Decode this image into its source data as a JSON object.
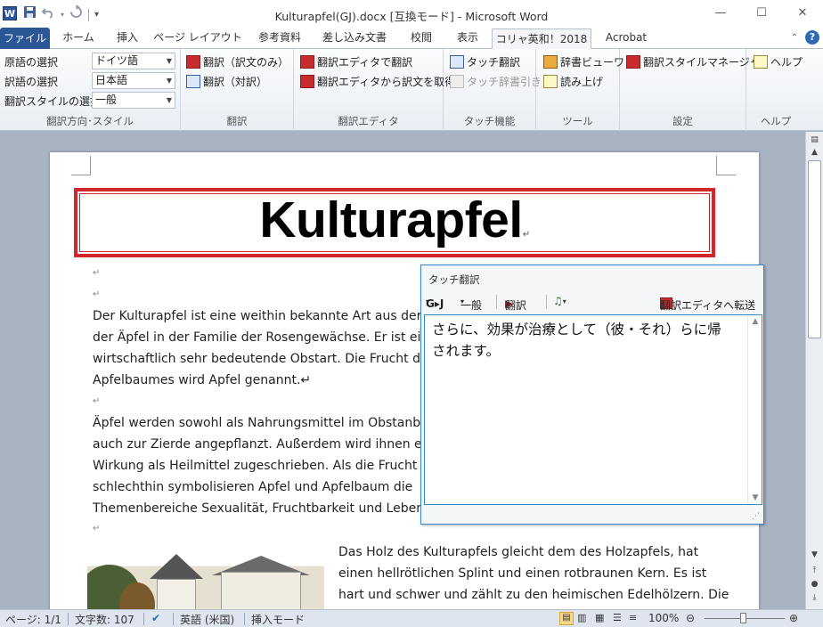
{
  "window": {
    "title": "Kulturapfel(GJ).docx [互換モード] - Microsoft Word",
    "app_icon_label": "W",
    "controls": {
      "minimize": "—",
      "maximize": "☐",
      "close": "✕"
    }
  },
  "quick_access": {
    "save_icon": "save-icon",
    "undo_icon": "undo-icon",
    "redo_icon": "redo-icon",
    "customize_icon": "customize-icon"
  },
  "tabs": [
    {
      "label": "ファイル"
    },
    {
      "label": "ホーム"
    },
    {
      "label": "挿入"
    },
    {
      "label": "ページ レイアウト"
    },
    {
      "label": "参考資料"
    },
    {
      "label": "差し込み文書"
    },
    {
      "label": "校閲"
    },
    {
      "label": "表示"
    },
    {
      "label": "コリャ英和！2018"
    },
    {
      "label": "Acrobat"
    }
  ],
  "active_tab": "コリャ英和！2018",
  "tab_help": "?",
  "ribbon": {
    "direction_group": {
      "label": "翻訳方向･スタイル",
      "source_label": "原語の選択",
      "source_value": "ドイツ語",
      "target_label": "訳語の選択",
      "target_value": "日本語",
      "style_label": "翻訳スタイルの選択",
      "style_value": "一般"
    },
    "translate_group": {
      "label": "翻訳",
      "translate_only": "翻訳（訳文のみ）",
      "translate_pair": "翻訳（対訳）"
    },
    "editor_group": {
      "label": "翻訳エディタ",
      "open_editor": "翻訳エディタで翻訳",
      "get_from_editor": "翻訳エディタから訳文を取得"
    },
    "touch_group": {
      "label": "タッチ機能",
      "touch_translate": "タッチ翻訳",
      "touch_dictionary": "タッチ辞書引き"
    },
    "tools_group": {
      "label": "ツール",
      "dictionary_viewer": "辞書ビューワ",
      "read_aloud": "読み上げ"
    },
    "settings_group": {
      "label": "設定",
      "style_manager": "翻訳スタイルマネージャ"
    },
    "help_group": {
      "label": "ヘルプ",
      "help": "ヘルプ"
    }
  },
  "document": {
    "title": "Kulturapfel",
    "para_mark": "↵",
    "para1": [
      "  Der Kulturapfel ist eine weithin bekannte Art aus der G",
      "der Äpfel in der Familie der Rosengewächse. Er ist eine",
      "wirtschaftlich sehr bedeutende Obstart. Die Frucht des",
      "Apfelbaumes wird Apfel genannt.↵"
    ],
    "para2": [
      "Äpfel werden sowohl als Nahrungsmittel im Obstanba",
      "auch zur Zierde angepflanzt. Außerdem wird ihnen ein",
      "Wirkung als Heilmittel zugeschrieben. Als die Frucht",
      "schlechthin symbolisieren Apfel und Apfelbaum die",
      "Themenbereiche Sexualität, Fruchtbarkeit und Leben,"
    ],
    "para3": [
      "Das Holz des Kulturapfels gleicht dem des Holzapfels, hat",
      "einen hellrötlichen Splint und einen rotbraunen Kern. Es ist",
      "hart und schwer und zählt zu den heimischen Edelhölzern. Die"
    ]
  },
  "touch_window": {
    "title": "タッチ翻訳",
    "direction": "G▸J",
    "style": "一般",
    "translate_button": "翻訳",
    "transfer_button": "翻訳エディタへ転送",
    "result_text": "さらに、効果が治療として（彼・それ）らに帰されます。"
  },
  "status": {
    "page": "ページ: 1/1",
    "words": "文字数: 107",
    "language": "英語 (米国)",
    "mode": "挿入モード",
    "zoom": "100%",
    "zoom_level": 1.0
  }
}
